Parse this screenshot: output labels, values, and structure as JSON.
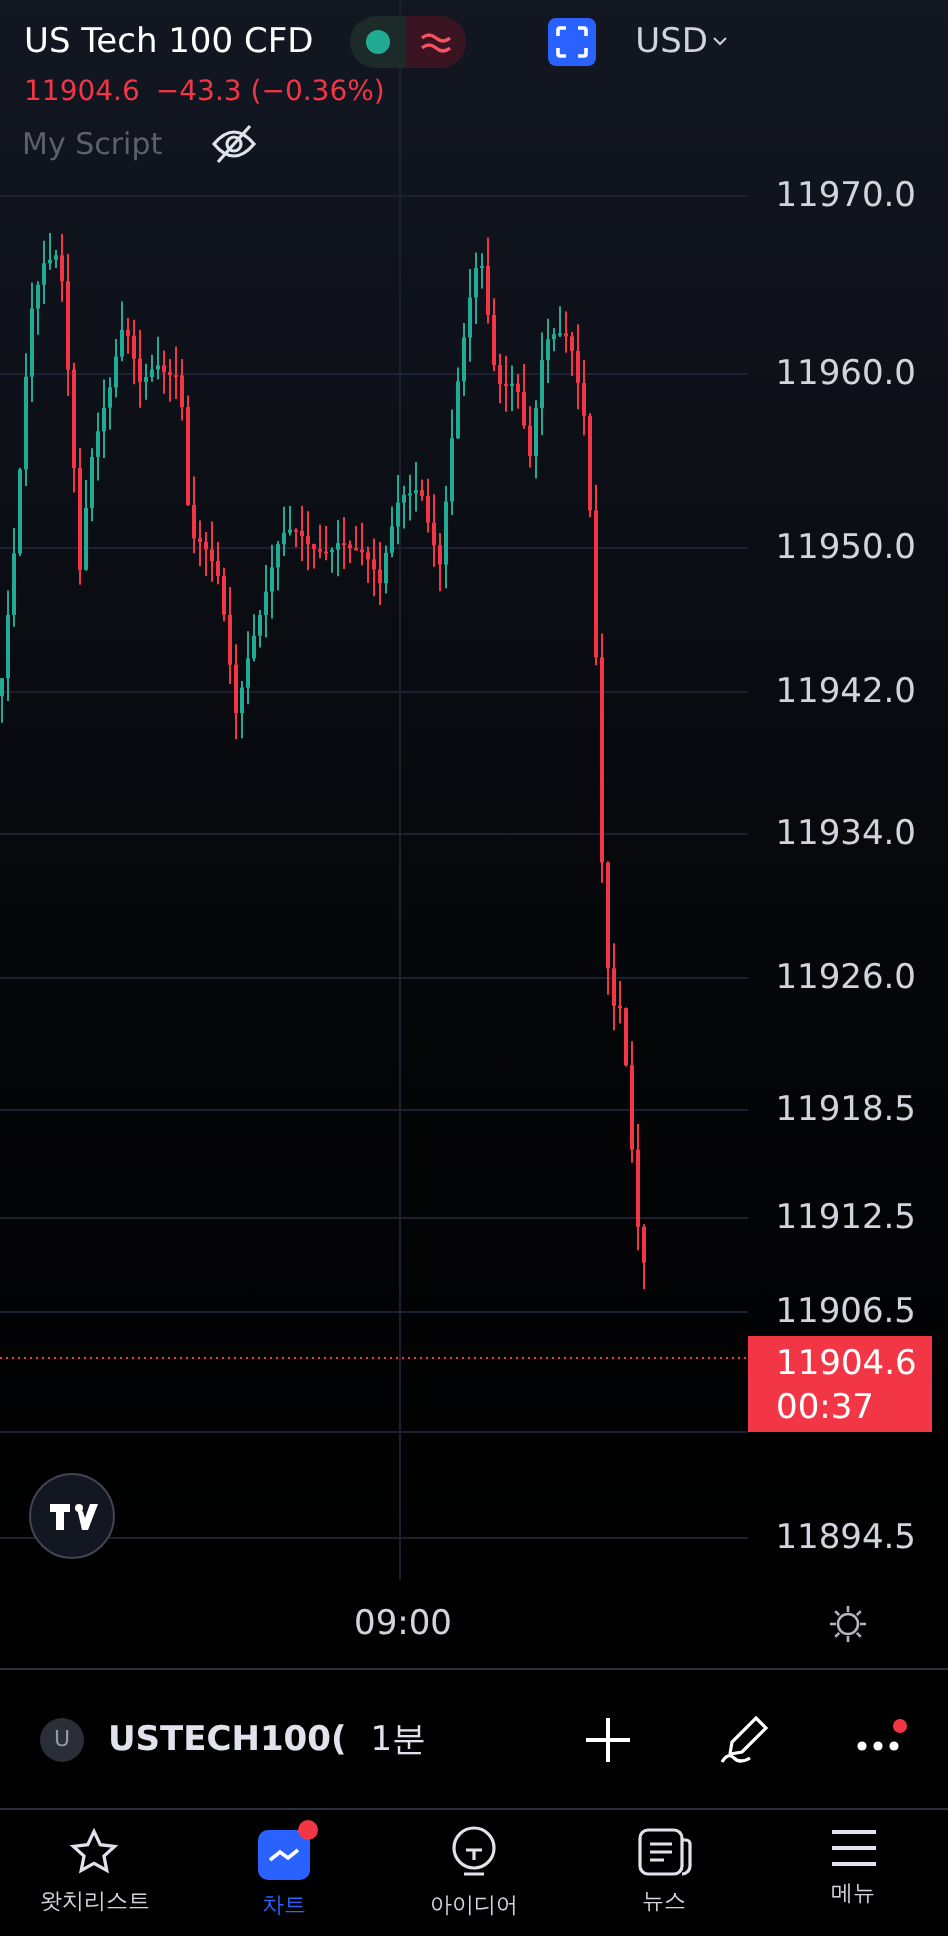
{
  "header": {
    "title": "US Tech 100 CFD",
    "price": "11904.6",
    "change": "−43.3 (−0.36%)",
    "currency": "USD"
  },
  "indicator": {
    "name": "My Script",
    "visible": false
  },
  "price_axis": [
    "11970.0",
    "11960.0",
    "11950.0",
    "11942.0",
    "11934.0",
    "11926.0",
    "11918.5",
    "11912.5",
    "11906.5",
    "11894.5"
  ],
  "last_price": {
    "price": "11904.6",
    "countdown": "00:37"
  },
  "time_axis": [
    "09:00"
  ],
  "symbol_bar": {
    "avatar": "U",
    "symbol": "USTECH100(",
    "interval": "1분",
    "notification": true
  },
  "nav": [
    {
      "label": "왓치리스트",
      "selected": false,
      "badge": false
    },
    {
      "label": "차트",
      "selected": true,
      "badge": true
    },
    {
      "label": "아이디어",
      "selected": false,
      "badge": false
    },
    {
      "label": "뉴스",
      "selected": false,
      "badge": false
    },
    {
      "label": "메뉴",
      "selected": false,
      "badge": false
    }
  ]
}
